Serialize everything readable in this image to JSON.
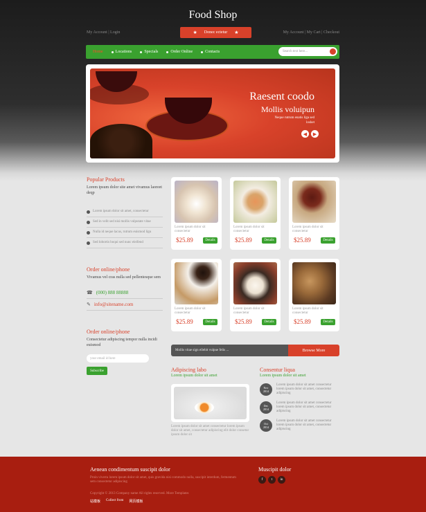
{
  "header": {
    "logo": "Food Shop",
    "left_links": "My Account | Login",
    "right_links": "My Account | My Cart | Checkout",
    "promo": "Donec ectetur"
  },
  "nav": {
    "items": [
      "Home",
      "Locations",
      "Specials",
      "Order Online",
      "Contacts"
    ],
    "search_placeholder": "Search text here..."
  },
  "slider": {
    "title": "Raesent coodo",
    "subtitle": "Mollis voluipun",
    "text": "Neque rutrum enatis liga sed loshet"
  },
  "popular": {
    "title": "Popular Products",
    "lead": "Lorem ipsum dolor site amet vivamus laoreet deqp",
    "bullets": [
      "Lorem ipsum dolor sit amet, consectetur",
      "Sed in velit sed nisi mollis vulputate vitae",
      "Nulla id neque lacus, rutrum euismod ligu",
      "Sed lobortis boqui sed nunc eleifend"
    ]
  },
  "order_phone": {
    "title": "Order online/phone",
    "lead": "Vivamus vel cras nulla sed pellentesque sem",
    "phone": "(000) 888 88888",
    "email": "info@sitename.com"
  },
  "order_subscribe": {
    "title": "Order online/phone",
    "lead": "Consectetur adipiscing tempor nulla incidi euismod",
    "email_placeholder": "your email id here",
    "button": "Subscribe"
  },
  "products": [
    {
      "desc": "Lorem ipsum dolor sit consectetur",
      "price": "$25.89",
      "button": "Details"
    },
    {
      "desc": "Lorem ipsum dolor sit consectetur",
      "price": "$25.89",
      "button": "Details"
    },
    {
      "desc": "Lorem ipsum dolor sit consectetur",
      "price": "$25.89",
      "button": "Details"
    },
    {
      "desc": "Lorem ipsum dolor sit consectetur",
      "price": "$25.89",
      "button": "Details"
    },
    {
      "desc": "Lorem ipsum dolor sit consectetur",
      "price": "$25.89",
      "button": "Details"
    },
    {
      "desc": "Lorem ipsum dolor sit consectetur",
      "price": "$25.89",
      "button": "Details"
    }
  ],
  "banner": {
    "text": "Mollis vitae sign ellebit vulpue felis ...",
    "button": "Browse More"
  },
  "advantages": {
    "title": "Adipiscing labo",
    "subtitle": "Lorem ipsum dolor sit amet",
    "text": "Lorem ipsum dolor sit amet consectetur lorem ipsum dolor sit amet, consectetur adipiscing elit dolor consetur ipsum dolor sit"
  },
  "news": {
    "title": "Consentur liqua",
    "subtitle": "Lorem ipsum dolor sit amet",
    "items": [
      {
        "month": "Nov",
        "year": "2014",
        "text": "Lorem ipsum dolor sit amet consectetur lorem ipsum dolor sit amet, consectetur adipiscing"
      },
      {
        "month": "Dec",
        "year": "2014",
        "text": "Lorem ipsum dolor sit amet consectetur lorem ipsum dolor sit amet, consectetur adipiscing"
      },
      {
        "month": "Oct",
        "year": "2014",
        "text": "Lorem ipsum dolor sit amet consectetur lorem ipsum dolor sit amet, consectetur adipiscing"
      }
    ]
  },
  "footer": {
    "title": "Aenean condimentum suscipit dolor",
    "text": "Proin viverra lorem ipsum dolor sit amet, quis gravida nisi commodo nulla, suscipit interdum, fermentum sem consectetur adipiscing",
    "copyright": "Copyright © 2013 Company name All rights reserved. More Templates",
    "links": [
      "站模板",
      "Collect from",
      "网页模板"
    ],
    "social_title": "Muscipit dolor",
    "social": [
      "f",
      "t",
      "in"
    ]
  },
  "colors": {
    "accent_red": "#d8412a",
    "accent_green": "#3aa12f",
    "footer_red": "#a81e10"
  }
}
